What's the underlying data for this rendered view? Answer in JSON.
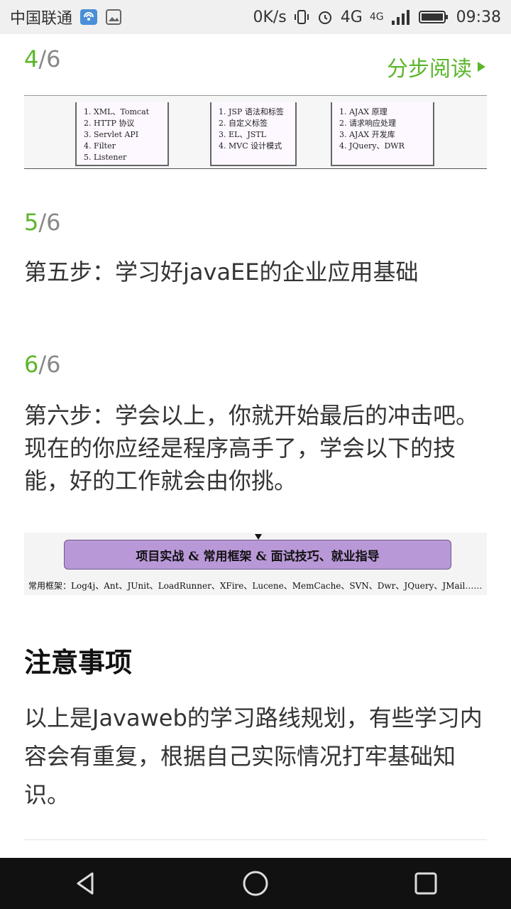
{
  "status_bar": {
    "carrier": "中国联通",
    "speed": "0K/s",
    "network1": "4G",
    "network2": "4G",
    "time": "09:38",
    "icons": [
      "wifi-hotspot-icon",
      "image-icon",
      "vibrate-icon",
      "alarm-icon",
      "signal-icon",
      "battery-icon"
    ]
  },
  "step4": {
    "current": "4",
    "total": "/6",
    "read_link": "分步阅读",
    "diagram": {
      "col1": [
        "1. XML、Tomcat",
        "2. HTTP 协议",
        "3. Servlet API",
        "4. Filter",
        "5. Listener"
      ],
      "col2": [
        "1. JSP 语法和标签",
        "2. 自定义标签",
        "3. EL、JSTL",
        "4. MVC 设计模式"
      ],
      "col3": [
        "1. AJAX 原理",
        "2. 请求响应处理",
        "3. AJAX 开发库",
        "4. JQuery、DWR"
      ]
    }
  },
  "step5": {
    "current": "5",
    "total": "/6",
    "text": "第五步：学习好javaEE的企业应用基础"
  },
  "step6": {
    "current": "6",
    "total": "/6",
    "text": "第六步：学会以上，你就开始最后的冲击吧。现在的你应经是程序高手了，学会以下的技能，好的工作就会由你挑。",
    "banner_title": "项目实战 & 常用框架 & 面试技巧、就业指导",
    "frameworks": "常用框架：Log4j、Ant、JUnit、LoadRunner、XFire、Lucene、MemCache、SVN、Dwr、JQuery、JMail……"
  },
  "notice": {
    "title": "注意事项",
    "text": "以上是Javaweb的学习路线规划，有些学习内容会有重复，根据自己实际情况打牢基础知识。"
  },
  "navbar": {
    "items": [
      "back-icon",
      "home-icon",
      "recents-icon"
    ]
  },
  "colors": {
    "accent": "#5bb62a",
    "banner": "#b998d8"
  }
}
